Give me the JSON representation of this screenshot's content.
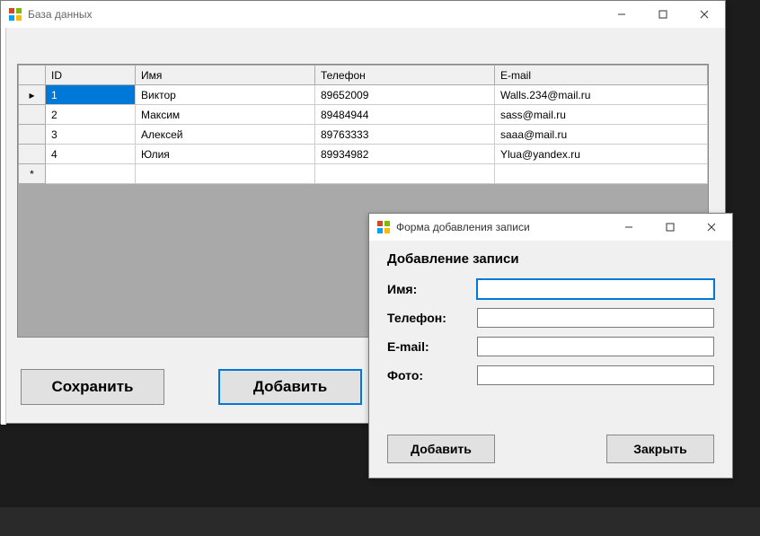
{
  "main_window": {
    "title": "База данных",
    "columns": {
      "id": "ID",
      "name": "Имя",
      "phone": "Телефон",
      "email": "E-mail"
    },
    "rows": [
      {
        "id": "1",
        "name": "Виктор",
        "phone": "89652009",
        "email": "Walls.234@mail.ru"
      },
      {
        "id": "2",
        "name": "Максим",
        "phone": "89484944",
        "email": "sass@mail.ru"
      },
      {
        "id": "3",
        "name": "Алексей",
        "phone": "89763333",
        "email": "saaa@mail.ru"
      },
      {
        "id": "4",
        "name": "Юлия",
        "phone": "89934982",
        "email": "Ylua@yandex.ru"
      }
    ],
    "buttons": {
      "save": "Сохранить",
      "add": "Добавить"
    },
    "row_indicator": "▸",
    "new_row_indicator": "*"
  },
  "dialog": {
    "title": "Форма добавления записи",
    "heading": "Добавление записи",
    "labels": {
      "name": "Имя:",
      "phone": "Телефон:",
      "email": "E-mail:",
      "photo": "Фото:"
    },
    "values": {
      "name": "",
      "phone": "",
      "email": "",
      "photo": ""
    },
    "buttons": {
      "add": "Добавить",
      "close": "Закрыть"
    }
  }
}
